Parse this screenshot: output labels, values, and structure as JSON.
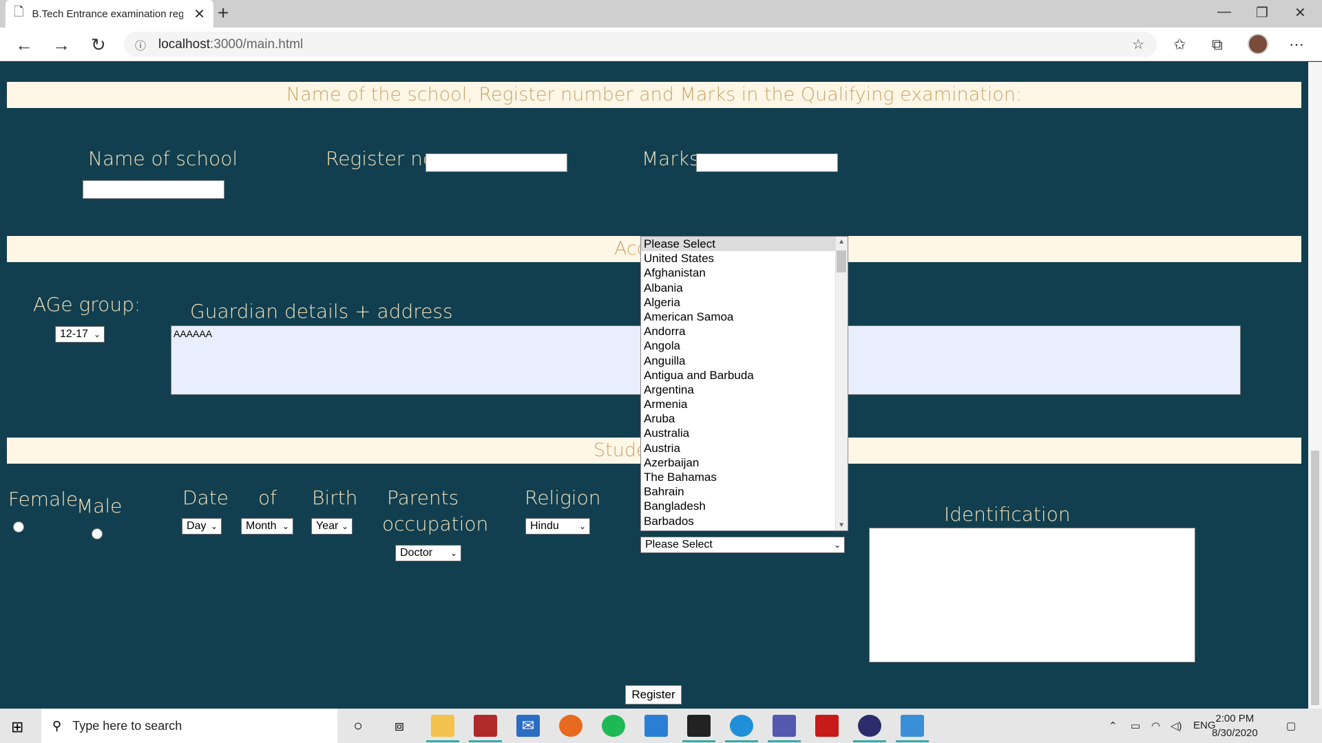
{
  "browser": {
    "tab_title": "B.Tech Entrance examination reg",
    "tab_close": "✕",
    "new_tab": "+",
    "url_host": "localhost",
    "url_path": ":3000/main.html"
  },
  "sections": {
    "qualifying": "Name of the school, Register number and Marks in the Qualifying examination:",
    "academic_partial": "Acc",
    "student_partial": "Stude"
  },
  "school": {
    "name_label": "Name of school",
    "register_label": "Register no",
    "marks_label": "Marks"
  },
  "guardian": {
    "age_label": "AGe group:",
    "age_value": "12-17",
    "guardian_label": "Guardian details + address",
    "guardian_value": "AAAAAA"
  },
  "student": {
    "female_label": "Female",
    "male_label": "Male",
    "date_label": "Date",
    "of_label": "of",
    "birth_label": "Birth",
    "day_value": "Day",
    "month_value": "Month",
    "year_value": "Year",
    "parents_label_1": "Parents",
    "parents_label_2": "occupation",
    "occupation_value": "Doctor",
    "religion_label": "Religion",
    "religion_value": "Hindu",
    "country_value": "Please Select",
    "identification_label": "Identification"
  },
  "country_options": [
    "Please Select",
    "United States",
    "Afghanistan",
    "Albania",
    "Algeria",
    "American Samoa",
    "Andorra",
    "Angola",
    "Anguilla",
    "Antigua and Barbuda",
    "Argentina",
    "Armenia",
    "Aruba",
    "Australia",
    "Austria",
    "Azerbaijan",
    "The Bahamas",
    "Bahrain",
    "Bangladesh",
    "Barbados"
  ],
  "register_button": "Register",
  "taskbar": {
    "search_placeholder": "Type here to search",
    "lang": "ENG",
    "time": "2:00 PM",
    "date": "8/30/2020"
  }
}
